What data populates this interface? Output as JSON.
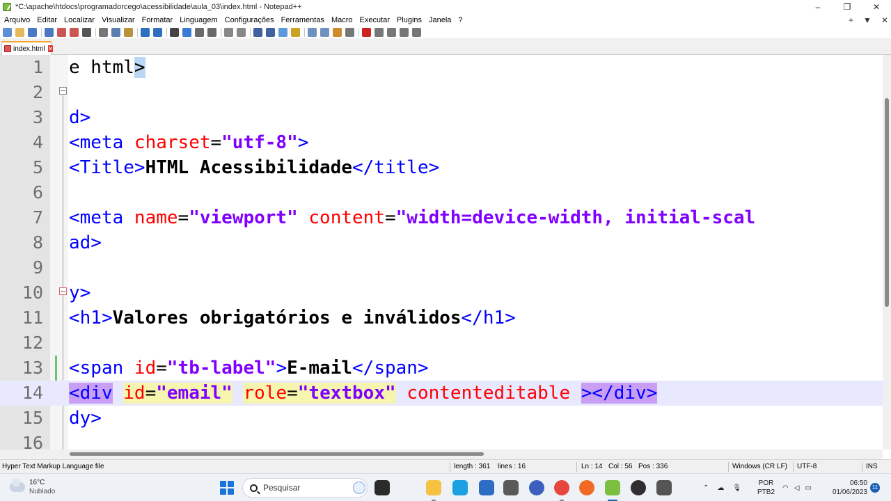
{
  "window": {
    "title": "*C:\\apache\\htdocs\\programadorcego\\acessibilidade\\aula_03\\index.html - Notepad++",
    "controls": {
      "minimize": "–",
      "maximize": "❐",
      "close": "✕"
    }
  },
  "menu": {
    "items": [
      "Arquivo",
      "Editar",
      "Localizar",
      "Visualizar",
      "Formatar",
      "Linguagem",
      "Configurações",
      "Ferramentas",
      "Macro",
      "Executar",
      "Plugins",
      "Janela",
      "?"
    ],
    "right": {
      "add": "+",
      "dropdown": "▼",
      "close": "✕"
    }
  },
  "toolbar": {
    "icons": [
      "new-file",
      "open-file",
      "save",
      "save-all",
      "close",
      "close-all",
      "print",
      "cut",
      "copy",
      "paste",
      "undo",
      "redo",
      "find",
      "replace",
      "zoom-in",
      "zoom-out",
      "sync-vertical",
      "sync-horizontal",
      "word-wrap",
      "show-all-chars",
      "indent-guide",
      "user-defined-language",
      "document-map",
      "function-list",
      "folder-as-workspace",
      "monitoring",
      "record-macro",
      "stop-macro",
      "play-macro",
      "run-macro-multiple",
      "save-macro"
    ]
  },
  "tab": {
    "label": "index.html",
    "close": "✕"
  },
  "editor": {
    "lines": [
      {
        "number": "1",
        "tokens": [
          {
            "t": "plain",
            "v": "e html"
          },
          {
            "t": "brace",
            "v": ">"
          }
        ]
      },
      {
        "number": "2",
        "tokens": []
      },
      {
        "number": "3",
        "tokens": [
          {
            "t": "tag",
            "v": "d>"
          }
        ]
      },
      {
        "number": "4",
        "tokens": [
          {
            "t": "tag",
            "v": "<meta "
          },
          {
            "t": "attr",
            "v": "charset"
          },
          {
            "t": "plain",
            "v": "="
          },
          {
            "t": "val",
            "v": "\"utf-8\""
          },
          {
            "t": "tag",
            "v": ">"
          }
        ]
      },
      {
        "number": "5",
        "tokens": [
          {
            "t": "tag",
            "v": "<Title>"
          },
          {
            "t": "text",
            "v": "HTML Acessibilidade"
          },
          {
            "t": "tag",
            "v": "</title>"
          }
        ]
      },
      {
        "number": "6",
        "tokens": []
      },
      {
        "number": "7",
        "tokens": [
          {
            "t": "tag",
            "v": "<meta "
          },
          {
            "t": "attr",
            "v": "name"
          },
          {
            "t": "plain",
            "v": "="
          },
          {
            "t": "val",
            "v": "\"viewport\""
          },
          {
            "t": "plain",
            "v": " "
          },
          {
            "t": "attr",
            "v": "content"
          },
          {
            "t": "plain",
            "v": "="
          },
          {
            "t": "val",
            "v": "\"width=device-width, initial-scal"
          }
        ]
      },
      {
        "number": "8",
        "tokens": [
          {
            "t": "tag",
            "v": "ad>"
          }
        ]
      },
      {
        "number": "9",
        "tokens": []
      },
      {
        "number": "10",
        "tokens": [
          {
            "t": "tag",
            "v": "y>"
          }
        ]
      },
      {
        "number": "11",
        "tokens": [
          {
            "t": "tag",
            "v": "<h1>"
          },
          {
            "t": "text",
            "v": "Valores obrigatórios e inválidos"
          },
          {
            "t": "tag",
            "v": "</h1>"
          }
        ]
      },
      {
        "number": "12",
        "tokens": []
      },
      {
        "number": "13",
        "tokens": [
          {
            "t": "tag",
            "v": "<span "
          },
          {
            "t": "attr",
            "v": "id"
          },
          {
            "t": "plain",
            "v": "="
          },
          {
            "t": "val",
            "v": "\"tb-label\""
          },
          {
            "t": "tag",
            "v": ">"
          },
          {
            "t": "text",
            "v": "E-mail"
          },
          {
            "t": "tag",
            "v": "</span>"
          }
        ]
      },
      {
        "number": "14",
        "current": true,
        "tokens": [
          {
            "t": "tag-hp",
            "v": "<div"
          },
          {
            "t": "plain",
            "v": " "
          },
          {
            "t": "attr-hy",
            "v": "id"
          },
          {
            "t": "plain-hy",
            "v": "="
          },
          {
            "t": "val-hy",
            "v": "\"email\""
          },
          {
            "t": "plain",
            "v": " "
          },
          {
            "t": "attr-hy",
            "v": "role"
          },
          {
            "t": "plain-hy",
            "v": "="
          },
          {
            "t": "val-hy",
            "v": "\"textbox\""
          },
          {
            "t": "plain",
            "v": " "
          },
          {
            "t": "attr",
            "v": "contenteditable"
          },
          {
            "t": "plain",
            "v": " "
          },
          {
            "t": "tag-hp",
            "v": "></div>"
          }
        ]
      },
      {
        "number": "15",
        "tokens": [
          {
            "t": "tag",
            "v": "dy>"
          }
        ]
      },
      {
        "number": "16",
        "tokens": []
      }
    ]
  },
  "status": {
    "file_type": "Hyper Text Markup Language file",
    "length": "length : 361",
    "lines": "lines : 16",
    "ln": "Ln : 14",
    "col": "Col : 56",
    "pos": "Pos : 336",
    "eol": "Windows (CR LF)",
    "encoding": "UTF-8",
    "mode": "INS"
  },
  "taskbar": {
    "weather_temp": "16°C",
    "weather_cond": "Nublado",
    "search_placeholder": "Pesquisar",
    "lang_line1": "POR",
    "lang_line2": "PTB2",
    "time": "06:50",
    "date": "01/06/2023",
    "notifications": "11",
    "apps": [
      "task-view",
      "edge",
      "file-explorer",
      "microsoft-store",
      "settings",
      "cortana",
      "chrome",
      "firefox",
      "notepad-plus-plus",
      "obs",
      "pen-tool"
    ],
    "colors": {
      "task-view": "#2b2b2b",
      "edge": "#1ba1e2",
      "file-explorer": "#f5c242",
      "microsoft-store": "#2d6ec4",
      "settings": "#5a5a5a",
      "cortana": "#3c5fbf",
      "chrome": "#e8453c",
      "firefox": "#f06a25",
      "notepad-plus-plus": "#7cbf3f",
      "obs": "#302e31",
      "pen-tool": "#555555"
    }
  },
  "colors": {
    "tag": "#0000ff",
    "attribute": "#ff0000",
    "value": "#8000ff",
    "current_line": "#e8e8ff",
    "tab_accent": "#f4a628"
  }
}
